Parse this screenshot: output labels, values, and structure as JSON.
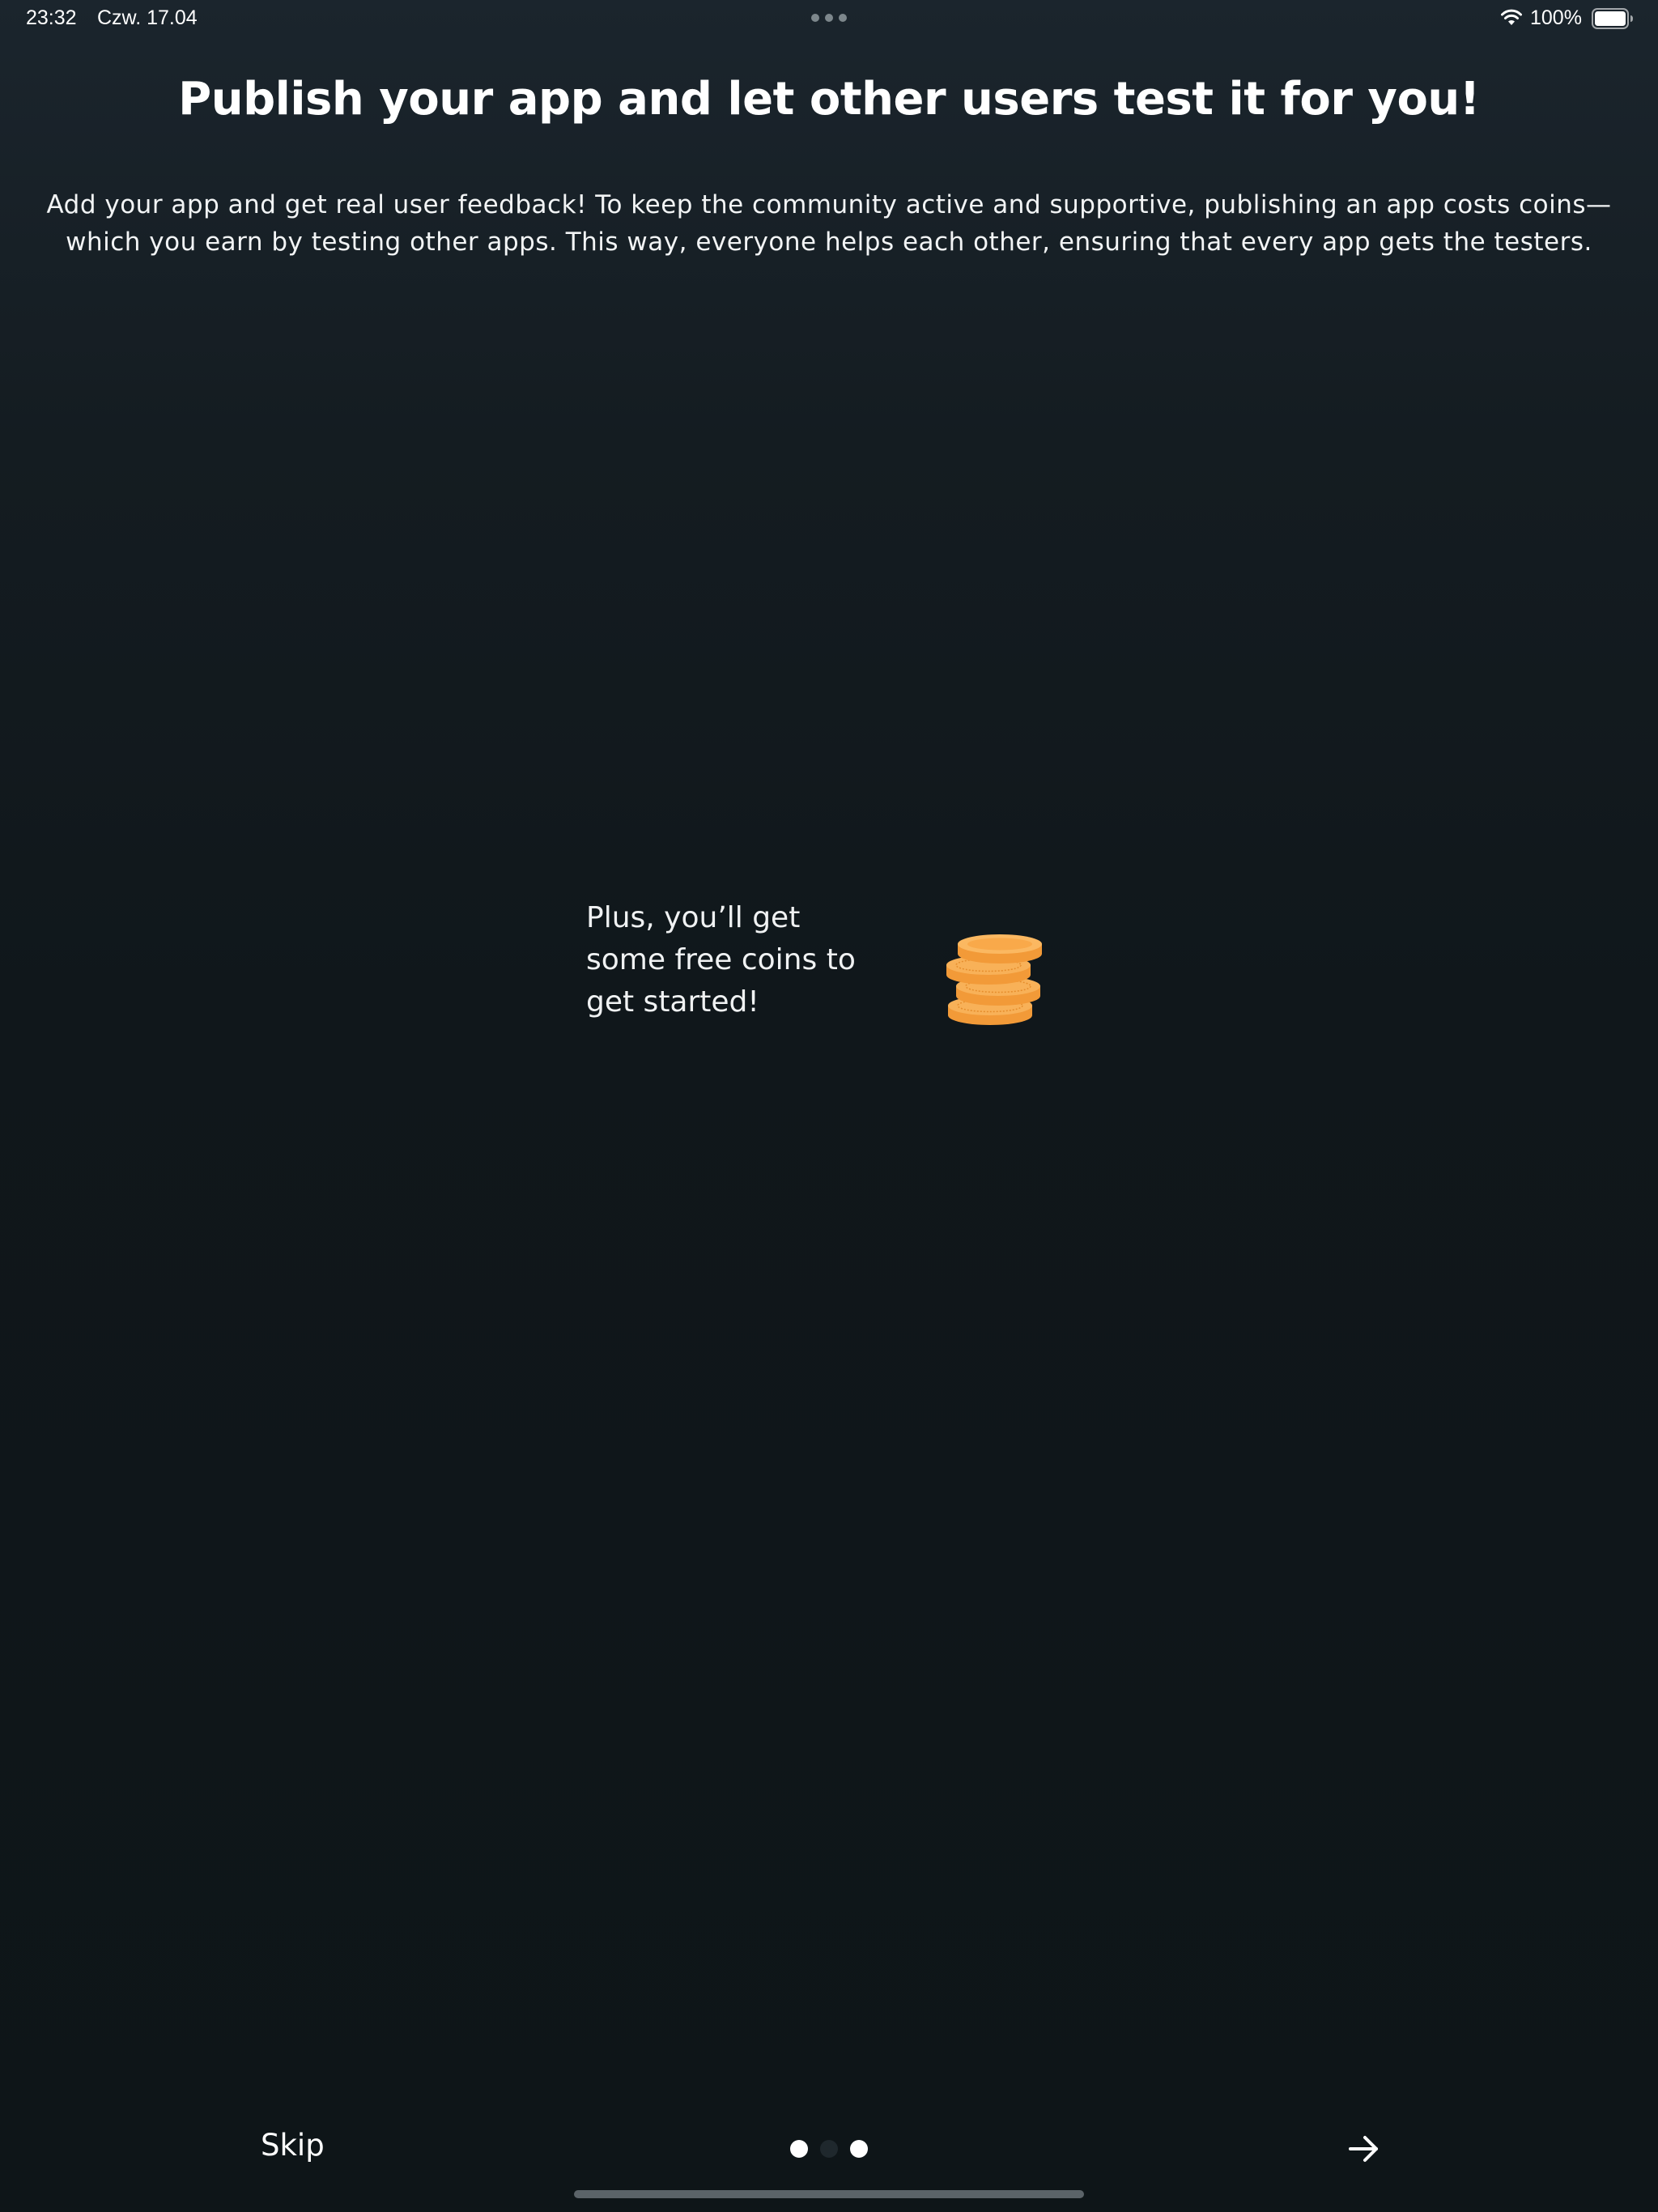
{
  "status_bar": {
    "time": "23:32",
    "date": "Czw. 17.04",
    "battery": "100%",
    "icons": [
      "wifi-icon",
      "battery-icon",
      "multitasking-dots-icon"
    ]
  },
  "onboarding": {
    "title": "Publish your app and let other users test it for you!",
    "description": "Add your app and get real user feedback! To keep the community active and supportive, publishing an app costs coins—which you earn by testing other apps. This way, everyone helps each other, ensuring that every app gets the testers.",
    "promo_text": "Plus, you’ll get some free coins to get started!",
    "promo_icon": "coins-stack-icon"
  },
  "navigation": {
    "skip_label": "Skip",
    "next_icon": "arrow-right-icon",
    "page_count": 3,
    "current_page": 2
  },
  "colors": {
    "background_top": "#1b252d",
    "background_bottom": "#0e1518",
    "text": "#ffffff",
    "coin": "#f6a442",
    "dot_inactive": "#1f282d"
  }
}
